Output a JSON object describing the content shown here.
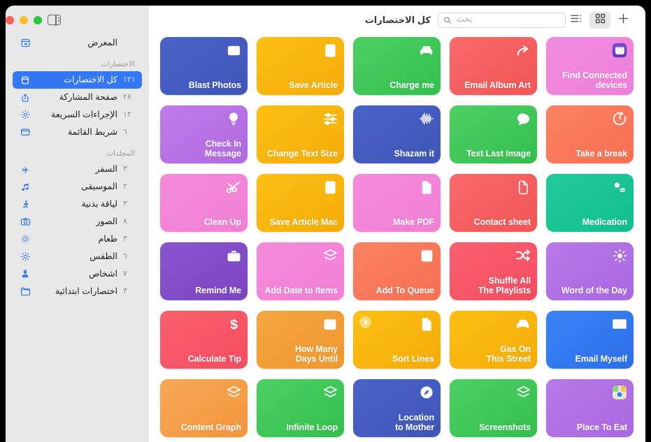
{
  "window": {
    "title": "كل الاختصارات",
    "traffic_lights": [
      "green",
      "yellow",
      "red"
    ],
    "sidebar_toggle_icon": "sidebar-toggle-icon"
  },
  "toolbar": {
    "search": {
      "placeholder": "بحث",
      "value": "",
      "icon": "search-icon"
    },
    "list_view_label": "list-view-icon",
    "grid_view_label": "grid-view-icon",
    "add_label": "plus-icon",
    "active_view": "grid"
  },
  "sidebar": {
    "top_items": [
      {
        "label": "المعرض",
        "icon": "gallery-icon",
        "count": ""
      }
    ],
    "sections": [
      {
        "header": "الاختصارات",
        "items": [
          {
            "label": "كل الاختصارات",
            "count": "١٢١",
            "icon": "shortcuts-icon",
            "selected": true
          },
          {
            "label": "صفحة المشاركة",
            "count": "٢٨",
            "icon": "share-icon",
            "selected": false
          },
          {
            "label": "الإجراءات السريعة",
            "count": "١٢",
            "icon": "gear-icon",
            "selected": false
          },
          {
            "label": "شريط القائمة",
            "count": "٦",
            "icon": "menubar-icon",
            "selected": false
          }
        ]
      },
      {
        "header": "المجلدات",
        "items": [
          {
            "label": "السفر",
            "count": "٣",
            "icon": "airplane-icon",
            "selected": false
          },
          {
            "label": "الموسيقى",
            "count": "٢",
            "icon": "music-note-icon",
            "selected": false
          },
          {
            "label": "لياقة بدنية",
            "count": "٣",
            "icon": "running-icon",
            "selected": false
          },
          {
            "label": "الصور",
            "count": "٨",
            "icon": "camera-icon",
            "selected": false
          },
          {
            "label": "طعام",
            "count": "٣",
            "icon": "plate-icon",
            "selected": false
          },
          {
            "label": "الطقس",
            "count": "٦",
            "icon": "sun-icon",
            "selected": false
          },
          {
            "label": "أشخاص",
            "count": "٧",
            "icon": "person-icon",
            "selected": false
          },
          {
            "label": "اختصارات ابتدائية",
            "count": "٣",
            "icon": "folder-icon",
            "selected": false
          }
        ]
      }
    ]
  },
  "colors": {
    "accent": "#3478f6",
    "sidebar_bg": "#e9e8e8",
    "selected_text": "#ffffff"
  },
  "shortcuts": [
    {
      "label": "Blast Photos",
      "icon": "photo-icon",
      "c1": "#4a63c8",
      "c2": "#3f56b8"
    },
    {
      "label": "Save Article",
      "icon": "article-icon",
      "c1": "#fcc014",
      "c2": "#f5ab07"
    },
    {
      "label": "Charge me",
      "icon": "car-charge-icon",
      "c1": "#4ed063",
      "c2": "#33bf4e"
    },
    {
      "label": "Email Album Art",
      "icon": "share-arrow-icon",
      "c1": "#f96a6a",
      "c2": "#f25454"
    },
    {
      "label": "Find Connected\ndevices",
      "icon": "app-disk-icon",
      "c1": "#f08de0",
      "c2": "#ee7fd9"
    },
    {
      "label": "Check In\nMessage",
      "icon": "lightbulb-icon",
      "c1": "#c07ce8",
      "c2": "#b168e0"
    },
    {
      "label": "Change Text Size",
      "icon": "sliders-icon",
      "c1": "#fcc014",
      "c2": "#f5ab07"
    },
    {
      "label": "Shazam it",
      "icon": "waveform-icon",
      "c1": "#4a63c8",
      "c2": "#3f56b8"
    },
    {
      "label": "Text Last Image",
      "icon": "message-plus-icon",
      "c1": "#4ed063",
      "c2": "#33bf4e"
    },
    {
      "label": "Take a break",
      "icon": "timer-icon",
      "c1": "#fa8264",
      "c2": "#f76f52"
    },
    {
      "label": "Clean Up",
      "icon": "scissors-icon",
      "c1": "#f48ada",
      "c2": "#f27fd4"
    },
    {
      "label": "Save Article Mac",
      "icon": "article-icon",
      "c1": "#fcc014",
      "c2": "#f5ab07"
    },
    {
      "label": "Make PDF",
      "icon": "pdf-doc-icon",
      "c1": "#f48ada",
      "c2": "#f27fd4"
    },
    {
      "label": "Contact sheet",
      "icon": "document-icon",
      "c1": "#f96a6a",
      "c2": "#f25454"
    },
    {
      "label": "Medication",
      "icon": "pills-icon",
      "c1": "#22cb9c",
      "c2": "#11bd8f"
    },
    {
      "label": "Remind Me",
      "icon": "briefcase-icon",
      "c1": "#8a55cd",
      "c2": "#7b45c2"
    },
    {
      "label": "Add Date to Items",
      "icon": "layers-icon",
      "c1": "#f48ada",
      "c2": "#f27fd4"
    },
    {
      "label": "Add To Queue",
      "icon": "tray-down-icon",
      "c1": "#fa8264",
      "c2": "#f76f52"
    },
    {
      "label": "Shuffle All\nThe Playlists",
      "icon": "shuffle-icon",
      "c1": "#f9606e",
      "c2": "#f44d60"
    },
    {
      "label": "Word of the Day",
      "icon": "sun-rays-icon",
      "c1": "#b77ae8",
      "c2": "#a967e1"
    },
    {
      "label": "Calculate Tip",
      "icon": "dollar-icon",
      "c1": "#f9606e",
      "c2": "#f44d60"
    },
    {
      "label": "How Many\nDays Until",
      "icon": "calendar-icon",
      "c1": "#f5a busca",
      "c2": "#f0982f"
    },
    {
      "label": "Sort Lines",
      "icon": "pdf-doc-icon",
      "c1": "#fcc014",
      "c2": "#f5ab07",
      "badge": "service-arrow-icon"
    },
    {
      "label": "Gas On\nThis Street",
      "icon": "car-charge-icon",
      "c1": "#fcc014",
      "c2": "#f5ab07"
    },
    {
      "label": "Email Myself",
      "icon": "envelope-icon",
      "c1": "#3b82f6",
      "c2": "#2b6fe8"
    },
    {
      "label": "Content Graph",
      "icon": "layers-icon",
      "c1": "#f7a857",
      "c2": "#f2953c"
    },
    {
      "label": "Infinite Loop",
      "icon": "layers-icon",
      "c1": "#4ed063",
      "c2": "#33bf4e"
    },
    {
      "label": "Location\nto Mother",
      "icon": "compass-icon",
      "c1": "#4a63c8",
      "c2": "#3f56b8"
    },
    {
      "label": "Screenshots",
      "icon": "layers-icon",
      "c1": "#4ed063",
      "c2": "#33bf4e"
    },
    {
      "label": "Place To Eat",
      "icon": "app-maps-icon",
      "c1": "#b77ae8",
      "c2": "#a967e1"
    }
  ]
}
